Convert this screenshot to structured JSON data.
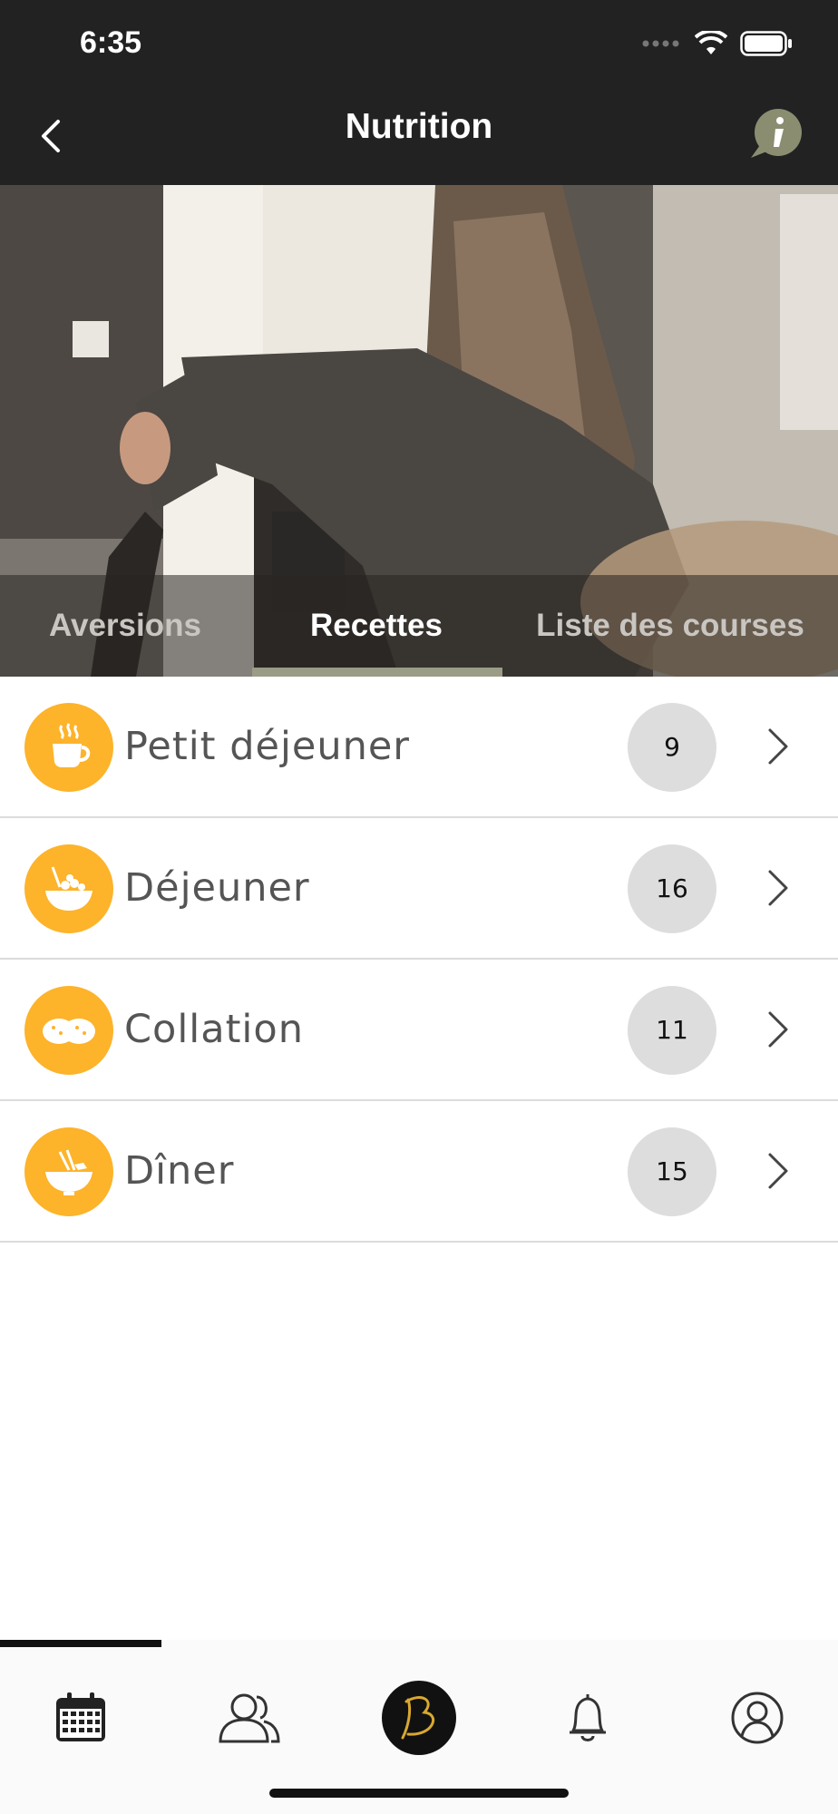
{
  "status_bar": {
    "time": "6:35"
  },
  "header": {
    "title": "Nutrition"
  },
  "tabs": [
    {
      "label": "Aversions",
      "active": false
    },
    {
      "label": "Recettes",
      "active": true
    },
    {
      "label": "Liste des courses",
      "active": false
    }
  ],
  "meals": [
    {
      "label": "Petit déjeuner",
      "count": "9",
      "icon": "coffee-cup-icon"
    },
    {
      "label": "Déjeuner",
      "count": "16",
      "icon": "salad-bowl-icon"
    },
    {
      "label": "Collation",
      "count": "11",
      "icon": "cookies-icon"
    },
    {
      "label": "Dîner",
      "count": "15",
      "icon": "noodle-bowl-icon"
    }
  ],
  "tabbar": {
    "items": [
      "calendar-icon",
      "community-icon",
      "brand-logo-icon",
      "bell-icon",
      "profile-icon"
    ],
    "active_index": 0
  },
  "colors": {
    "accent": "#fdb32a",
    "header_bg": "#222222",
    "count_badge": "#dddddd",
    "tab_underline": "#9a9c86",
    "info_button": "#8a8d70"
  }
}
